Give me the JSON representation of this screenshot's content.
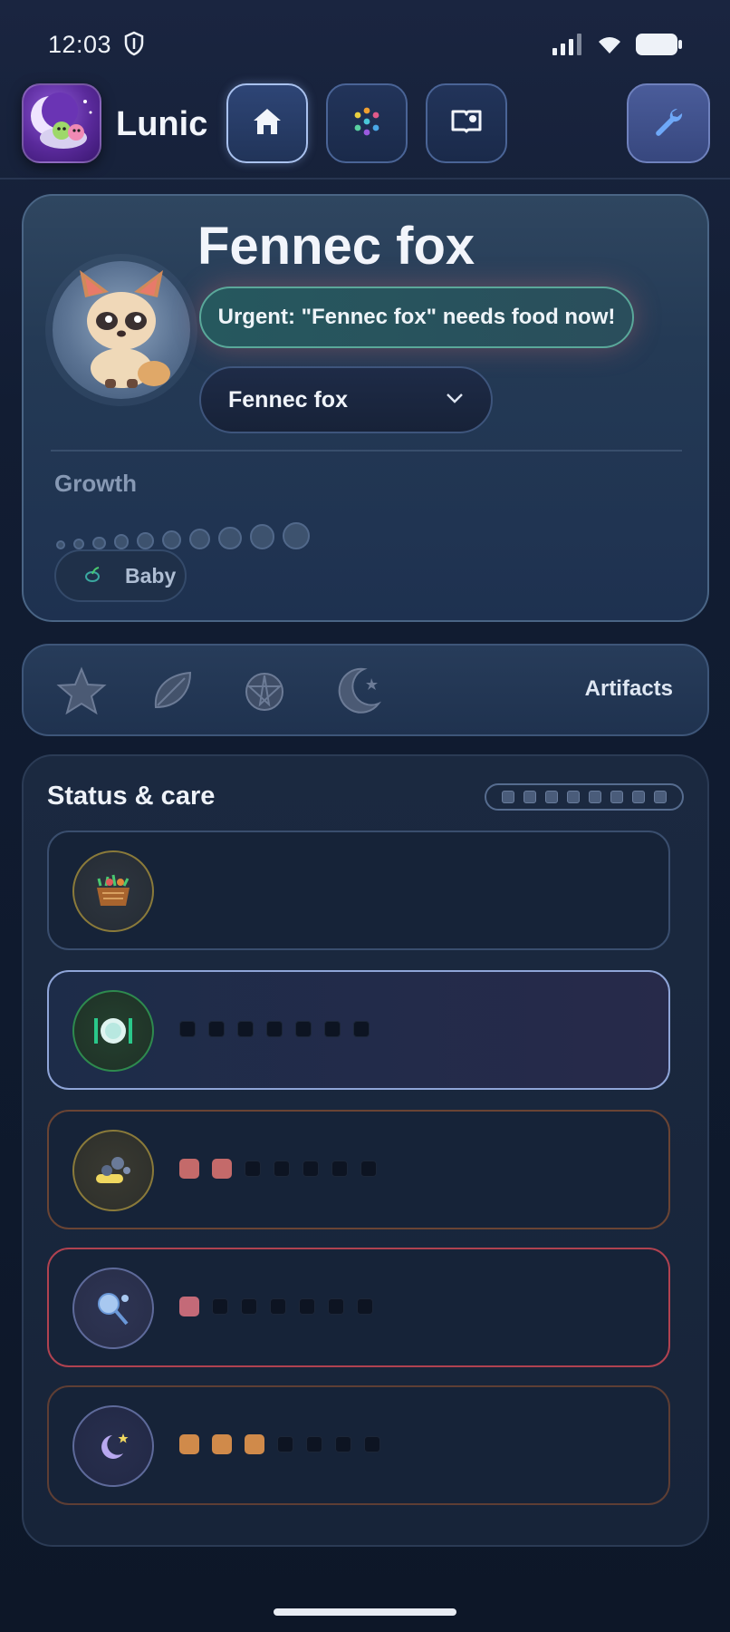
{
  "status_bar": {
    "time": "12:03"
  },
  "app": {
    "name": "Lunic"
  },
  "nav": {
    "home": "home-icon",
    "activities": "dots-icon",
    "journal": "book-icon",
    "settings": "wrench-icon"
  },
  "pet": {
    "name": "Fennec fox",
    "alert": "Urgent: \"Fennec fox\" needs food now!",
    "selected": "Fennec fox",
    "growth_label": "Growth",
    "growth_stage": "Baby",
    "growth_steps": 10,
    "growth_filled": 0
  },
  "artifacts": {
    "label": "Artifacts",
    "items": [
      "star-icon",
      "leaf-icon",
      "pentagram-icon",
      "moon-icon"
    ]
  },
  "status": {
    "title": "Status & care",
    "pages": 8,
    "rows": [
      {
        "name": "basket",
        "icon": "basket-icon",
        "level": 0,
        "max": 0,
        "accent": "#c49a3a",
        "border": "#3f5477"
      },
      {
        "name": "food",
        "icon": "plate-icon",
        "level": 0,
        "max": 7,
        "accent": "#3fa86a",
        "border": "#8fa5d8"
      },
      {
        "name": "bath",
        "icon": "soap-icon",
        "level": 2,
        "max": 7,
        "accent": "#c49a3a",
        "border": "#7a4a3a",
        "fill": "#c46a6a"
      },
      {
        "name": "play",
        "icon": "racket-icon",
        "level": 1,
        "max": 7,
        "accent": "#6a7ab4",
        "border": "#b84a58",
        "fill": "#c46a78"
      },
      {
        "name": "sleep",
        "icon": "moon-icon",
        "level": 3,
        "max": 7,
        "accent": "#6a7ab4",
        "border": "#6e4838",
        "fill": "#d08a4a"
      }
    ]
  }
}
